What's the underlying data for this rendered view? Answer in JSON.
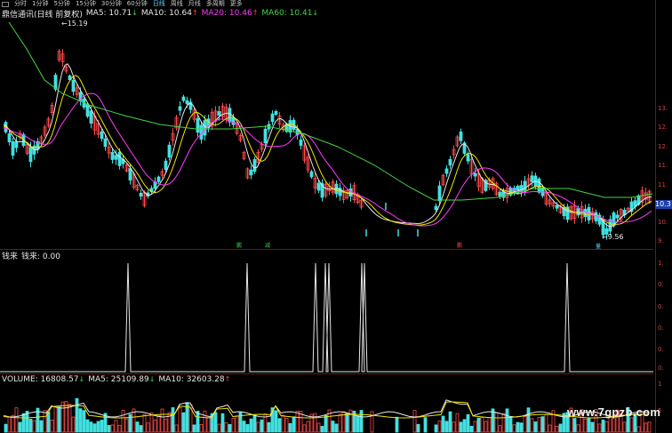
{
  "toolbar": {
    "items": [
      "分时",
      "1分钟",
      "5分钟",
      "15分钟",
      "30分钟",
      "60分钟",
      "日线",
      "周线",
      "月线",
      "多周期",
      "更多"
    ],
    "active": "日线"
  },
  "main": {
    "title": "鼎信通讯(日线 前复权)",
    "ma5_label": "MA5: 10.71",
    "ma5_arrow": "↓",
    "ma10_label": "MA10: 10.64",
    "ma10_arrow": "↑",
    "ma20_label": "MA20: 10.46",
    "ma20_arrow": "↑",
    "ma60_label": "MA60: 10.41",
    "ma60_arrow": "↓",
    "high_annot": "15.19",
    "low_annot": "9.56",
    "price_tag": "10.3",
    "y_ticks": [
      "13.",
      "12.",
      "12.",
      "11.",
      "11.",
      "10.",
      "9."
    ],
    "signals": [
      "鹏",
      "减",
      "",
      "鹏",
      "",
      "量"
    ]
  },
  "indicator": {
    "title": "钱来",
    "value_label": "钱来: 0.00",
    "y_ticks": [
      "1.",
      "0.",
      "0.",
      "0.",
      "0.",
      "0."
    ]
  },
  "volume": {
    "label": "VOLUME: 16808.57",
    "arrow1": "↓",
    "ma5_label": "MA5: 25109.89",
    "arrow2": "↓",
    "ma10_label": "MA10: 32603.28",
    "arrow3": "↑",
    "y_ticks": [
      "1",
      "5"
    ]
  },
  "watermark": "www.7gpzb.com",
  "colors": {
    "up": "#ff4a4a",
    "down": "#43e0e0",
    "ma5": "#e6e6e6",
    "ma10": "#f2e600",
    "ma20": "#ff3cff",
    "ma60": "#43d443",
    "frame": "#7a1010",
    "price_tag_bg": "#1e3fa8"
  }
}
